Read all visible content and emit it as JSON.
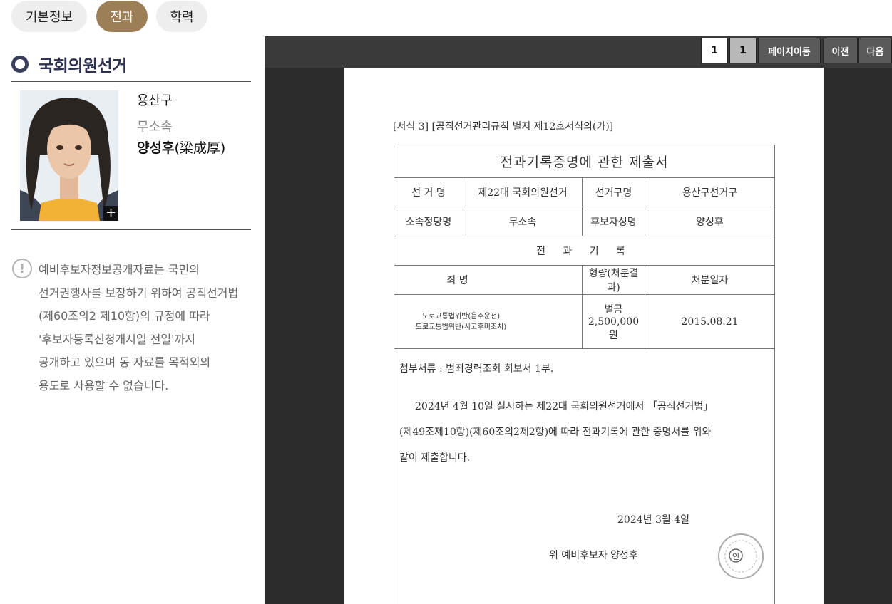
{
  "tabs": [
    {
      "label": "기본정보"
    },
    {
      "label": "전과"
    },
    {
      "label": "학력"
    }
  ],
  "section": {
    "title": "국회의원선거"
  },
  "candidate": {
    "district": "용산구",
    "party": "무소속",
    "name": "양성후",
    "hanja": "(梁成厚)",
    "photo_plus": "+"
  },
  "notice": {
    "icon": "!",
    "lines": [
      "예비후보자정보공개자료는 국민의",
      "선거권행사를 보장하기 위하여 공직선거법",
      "(제60조의2 제10항)의 규정에 따라",
      "'후보자등록신청개시일 전일'까지",
      "공개하고 있으며 동 자료를 목적외의",
      "용도로 사용할 수 없습니다."
    ]
  },
  "viewer": {
    "page_current": "1",
    "page_total": "1",
    "move_label": "페이지이동",
    "prev_label": "이전",
    "next_label": "다음"
  },
  "document": {
    "form_label": "[서식 3] [공직선거관리규칙 별지 제12호서식의(카)]",
    "title": "전과기록증명에 관한 제출서",
    "election_name_label": "선 거 명",
    "election_name": "제22대 국회의원선거",
    "district_label": "선거구명",
    "district": "용산구선거구",
    "party_label": "소속정당명",
    "party": "무소속",
    "candidate_label": "후보자성명",
    "candidate": "양성후",
    "records_header": "전 과 기 록",
    "col_crime": "죄 명",
    "col_sentence": "형량(처분결과)",
    "col_date": "처분일자",
    "crime_1": "도로교통법위반(음주운전)",
    "crime_2": "도로교통법위반(사고후미조치)",
    "sentence": "벌금 2,500,000 원",
    "date": "2015.08.21",
    "attachment": "첨부서류 : 범죄경력조회 회보서 1부.",
    "body_lines": [
      "2024년 4월 10일 실시하는 제22대 국회의원선거에서 「공직선거법」",
      "(제49조제10항)(제60조의2제2항)에 따라 전과기록에 관한 증명서를 위와",
      "같이 제출합니다."
    ],
    "submit_date": "2024년   3월  4일",
    "signer": "위   예비후보자        양성후",
    "seal_mark": "인"
  },
  "colors": {
    "active_tab": "#9c7f57",
    "inactive_tab": "#eeeeee",
    "viewer_bg": "#2c2c2c",
    "title_color": "#2d3150"
  }
}
